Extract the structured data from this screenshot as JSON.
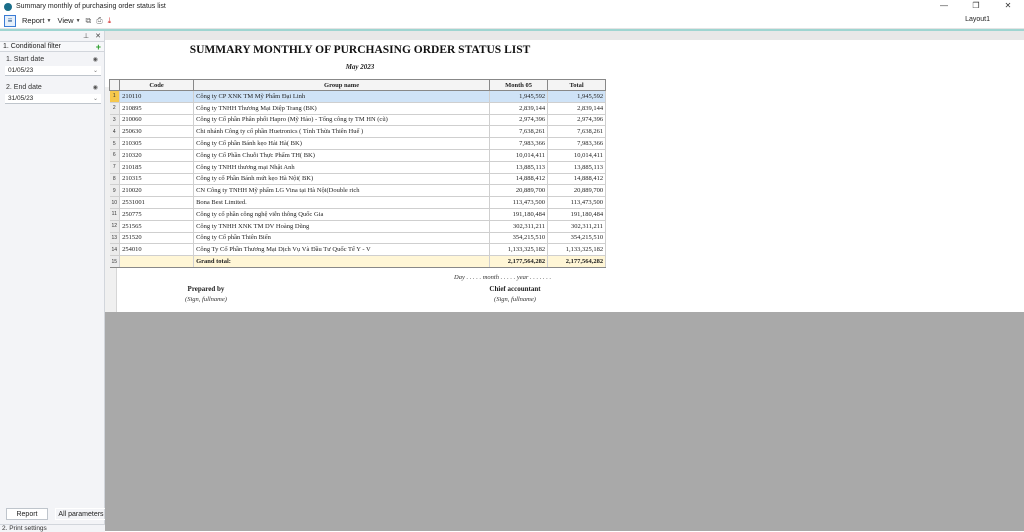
{
  "window": {
    "title": "Summary monthly of purchasing order status list",
    "controls": [
      "—",
      "❐",
      "✕"
    ]
  },
  "toolbar": {
    "menu_icon": "menu-icon",
    "report_label": "Report",
    "view_label": "View",
    "layout_label": "Layout1"
  },
  "sidebar": {
    "section_title": "1. Conditional filter",
    "start_label": "1. Start date",
    "start_value": "01/05/23",
    "end_label": "2. End date",
    "end_value": "31/05/23",
    "report_button": "Report",
    "all_params_button": "All parameters",
    "print_settings": "2. Print settings"
  },
  "report": {
    "title": "SUMMARY MONTHLY OF PURCHASING ORDER STATUS LIST",
    "subtitle": "May 2023",
    "columns": [
      "Code",
      "Group name",
      "Month 05",
      "Total"
    ],
    "rows": [
      {
        "n": "1",
        "code": "210110",
        "name": "Công ty CP XNK TM Mỹ Phẩm Đại Linh",
        "month": "1,945,592",
        "total": "1,945,592"
      },
      {
        "n": "2",
        "code": "210895",
        "name": "Công ty TNHH Thương Mại Diệp Trang (BK)",
        "month": "2,839,144",
        "total": "2,839,144"
      },
      {
        "n": "3",
        "code": "210060",
        "name": "Công ty Cổ phần Phân phối Hapro (Mỹ Hảo) - Tổng công ty TM HN (cũ)",
        "month": "2,974,396",
        "total": "2,974,396"
      },
      {
        "n": "4",
        "code": "250630",
        "name": "Chi nhánh Công ty cổ phần Huetronics ( Tỉnh Thừa Thiên Huế )",
        "month": "7,638,261",
        "total": "7,638,261"
      },
      {
        "n": "5",
        "code": "210305",
        "name": "Công ty Cổ phần Bánh kẹo Hải Hà( BK)",
        "month": "7,983,366",
        "total": "7,983,366"
      },
      {
        "n": "6",
        "code": "210320",
        "name": "Công ty Cổ Phần Chuỗi Thực Phẩm TH( BK)",
        "month": "10,014,411",
        "total": "10,014,411"
      },
      {
        "n": "7",
        "code": "210185",
        "name": "Công ty TNHH thương mại Nhật Anh",
        "month": "13,885,113",
        "total": "13,885,113"
      },
      {
        "n": "8",
        "code": "210315",
        "name": "Công ty cổ Phần Bánh mứt kẹo Hà Nội( BK)",
        "month": "14,888,412",
        "total": "14,888,412"
      },
      {
        "n": "9",
        "code": "210020",
        "name": "CN Công ty TNHH Mỹ phẩm LG Vina tại Hà Nội(Double rich",
        "month": "20,889,700",
        "total": "20,889,700"
      },
      {
        "n": "10",
        "code": "2531001",
        "name": "Bona Best Limited.",
        "month": "113,473,500",
        "total": "113,473,500"
      },
      {
        "n": "11",
        "code": "250775",
        "name": "Công ty cổ phần công nghệ viễn thông Quốc Gia",
        "month": "191,180,484",
        "total": "191,180,484"
      },
      {
        "n": "12",
        "code": "251565",
        "name": "Công ty TNHH XNK TM DV Hoàng Dũng",
        "month": "302,311,211",
        "total": "302,311,211"
      },
      {
        "n": "13",
        "code": "251520",
        "name": "Công ty Cổ phần Thiên Biển",
        "month": "354,215,510",
        "total": "354,215,510"
      },
      {
        "n": "14",
        "code": "254010",
        "name": "Công Ty Cổ Phần Thương Mại Dịch Vụ Và Đầu Tư Quốc Tế Y - V",
        "month": "1,133,325,182",
        "total": "1,133,325,182"
      }
    ],
    "total_row": {
      "n": "15",
      "label": "Grand total:",
      "month": "2,177,564,282",
      "total": "2,177,564,282"
    },
    "date_line": "Day . . . . . month . . . . . year . . . . . . .",
    "prepared_by": "Prepared by",
    "prepared_note": "(Sign, fullname)",
    "chief_accountant": "Chief accountant",
    "chief_note": "(Sign, fullname)"
  }
}
